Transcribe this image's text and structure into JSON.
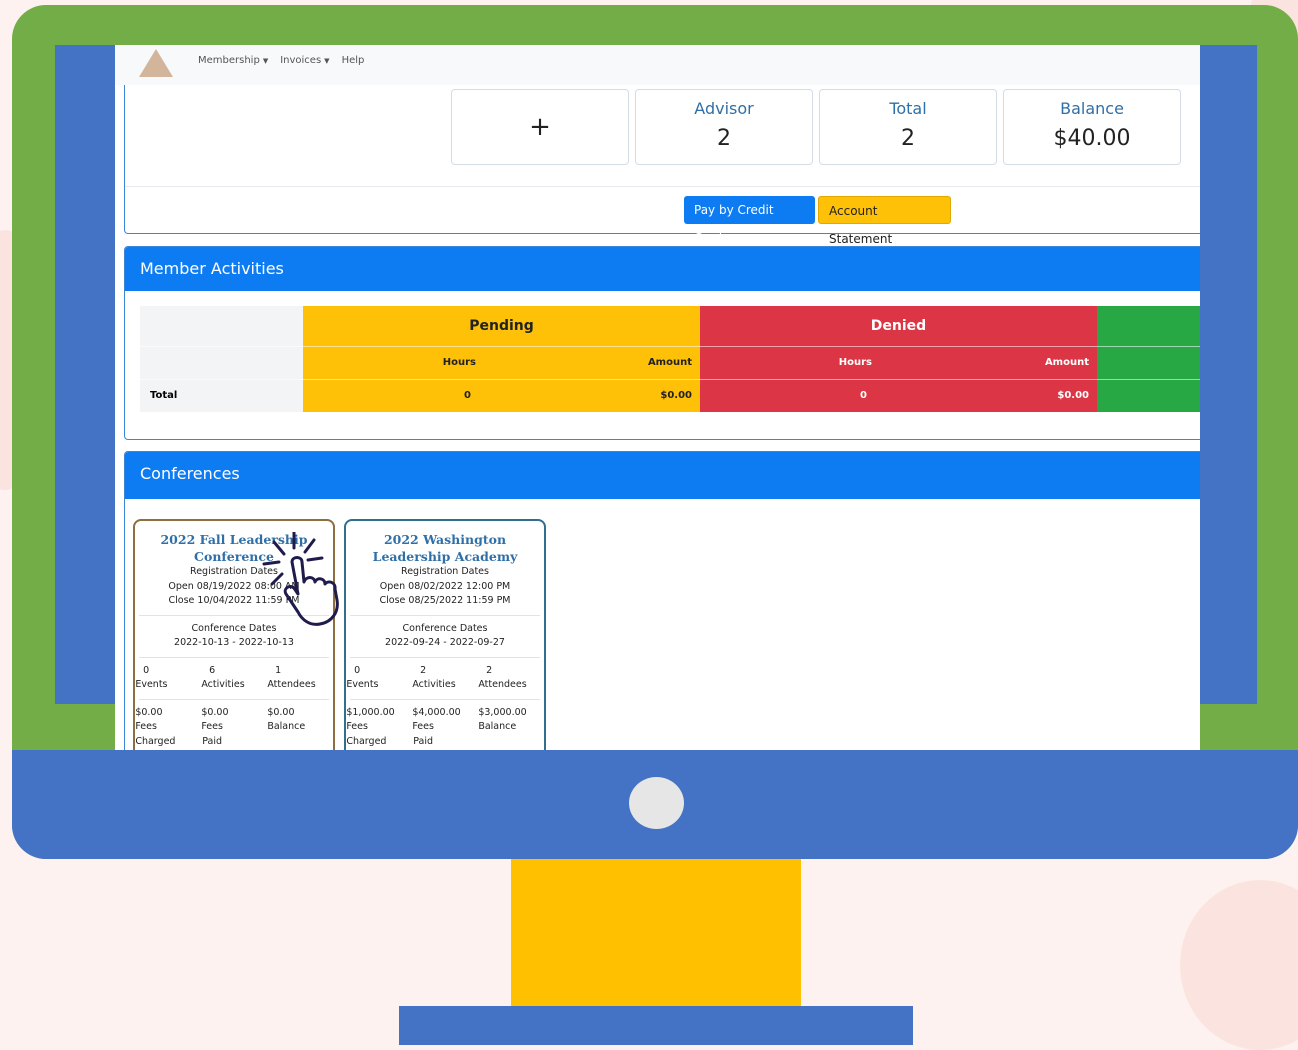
{
  "nav": {
    "items": [
      {
        "label": "Membership",
        "caret": true
      },
      {
        "label": "Invoices",
        "caret": true
      },
      {
        "label": "Help",
        "caret": false
      }
    ]
  },
  "summary": {
    "add_label": "+",
    "advisor": {
      "label": "Advisor",
      "value": "2"
    },
    "total": {
      "label": "Total",
      "value": "2"
    },
    "balance": {
      "label": "Balance",
      "value": "$40.00"
    },
    "pay_button": "Pay by Credit Card",
    "statement_button": "Account Statement"
  },
  "activities": {
    "title": "Member Activities",
    "pending_label": "Pending",
    "denied_label": "Denied",
    "hours_label": "Hours",
    "amount_label": "Amount",
    "total_label": "Total",
    "pending_hours": "0",
    "pending_amount": "$0.00",
    "denied_hours": "0",
    "denied_amount": "$0.00"
  },
  "conferences": {
    "title": "Conferences",
    "cards": [
      {
        "title": "2022 Fall Leadership Conference",
        "reg_label": "Registration Dates",
        "open": "Open 08/19/2022 08:00 AM",
        "close": "Close 10/04/2022 11:59 PM",
        "conf_label": "Conference Dates",
        "conf_dates": "2022-10-13 - 2022-10-13",
        "events": "0",
        "events_label": "Events",
        "activities": "6",
        "activities_label": "Activities",
        "attendees": "1",
        "attendees_label": "Attendees",
        "fees_charged": "$0.00",
        "fees_charged_label": "Fees Charged",
        "fees_paid": "$0.00",
        "fees_paid_label": "Fees Paid",
        "balance": "$0.00",
        "balance_label": "Balance"
      },
      {
        "title": "2022 Washington Leadership Academy",
        "reg_label": "Registration Dates",
        "open": "Open 08/02/2022 12:00 PM",
        "close": "Close 08/25/2022 11:59 PM",
        "conf_label": "Conference Dates",
        "conf_dates": "2022-09-24 - 2022-09-27",
        "events": "0",
        "events_label": "Events",
        "activities": "2",
        "activities_label": "Activities",
        "attendees": "2",
        "attendees_label": "Attendees",
        "fees_charged": "$1,000.00",
        "fees_charged_label": "Fees Charged",
        "fees_paid": "$4,000.00",
        "fees_paid_label": "Fees Paid",
        "balance": "$3,000.00",
        "balance_label": "Balance"
      }
    ]
  },
  "colors": {
    "frame_green": "#72ad47",
    "frame_blue": "#4472c4",
    "stand_yellow": "#ffc000",
    "primary": "#0d7cf3",
    "pending": "#ffc107",
    "denied": "#dc3545",
    "approved": "#28a745"
  },
  "icons": {
    "cursor": "tap-hand-icon",
    "logo": "triangle-logo-icon"
  }
}
